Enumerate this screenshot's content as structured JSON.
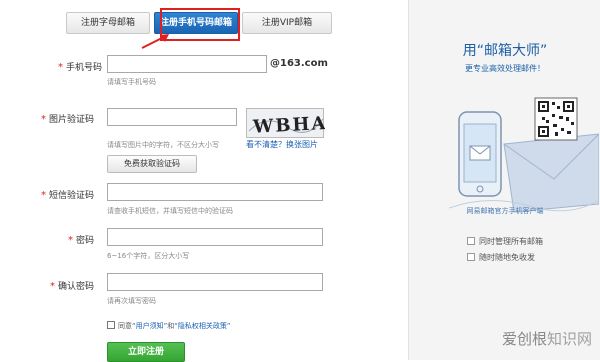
{
  "tabs": [
    {
      "label": "注册字母邮箱"
    },
    {
      "label": "注册手机号码邮箱"
    },
    {
      "label": "注册VIP邮箱"
    }
  ],
  "form": {
    "phone": {
      "label": "手机号码",
      "value": "",
      "suffix": "@163.com",
      "hint": "请填写手机号码"
    },
    "captcha": {
      "label": "图片验证码",
      "value": "",
      "hint": "请填写图片中的字符，不区分大小写",
      "image_text": "WBHA",
      "refresh_link": "看不清楚？换张图片",
      "get_button": "免费获取验证码"
    },
    "sms": {
      "label": "短信验证码",
      "value": "",
      "hint": "请查收手机短信，并填写短信中的验证码"
    },
    "password": {
      "label": "密码",
      "value": "",
      "hint": "6~16个字符，区分大小写"
    },
    "confirm": {
      "label": "确认密码",
      "value": "",
      "hint": "请再次填写密码"
    },
    "agree": {
      "prefix": "同意",
      "link1": "“用户须知”",
      "and": "和",
      "link2": "“隐私权相关政策”"
    },
    "submit": "立即注册"
  },
  "promo": {
    "title": "用“邮箱大师”",
    "subtitle": "更专业高效处理邮件！",
    "client_label": "网易邮箱官方手机客户端",
    "features": [
      "同时管理所有邮箱",
      "随时随地免收发"
    ]
  },
  "watermark": {
    "text1": "爱创根",
    "text2": "知识网"
  },
  "colors": {
    "accent": "#1b64b3",
    "submit": "#34a532",
    "highlight": "#e02020"
  }
}
